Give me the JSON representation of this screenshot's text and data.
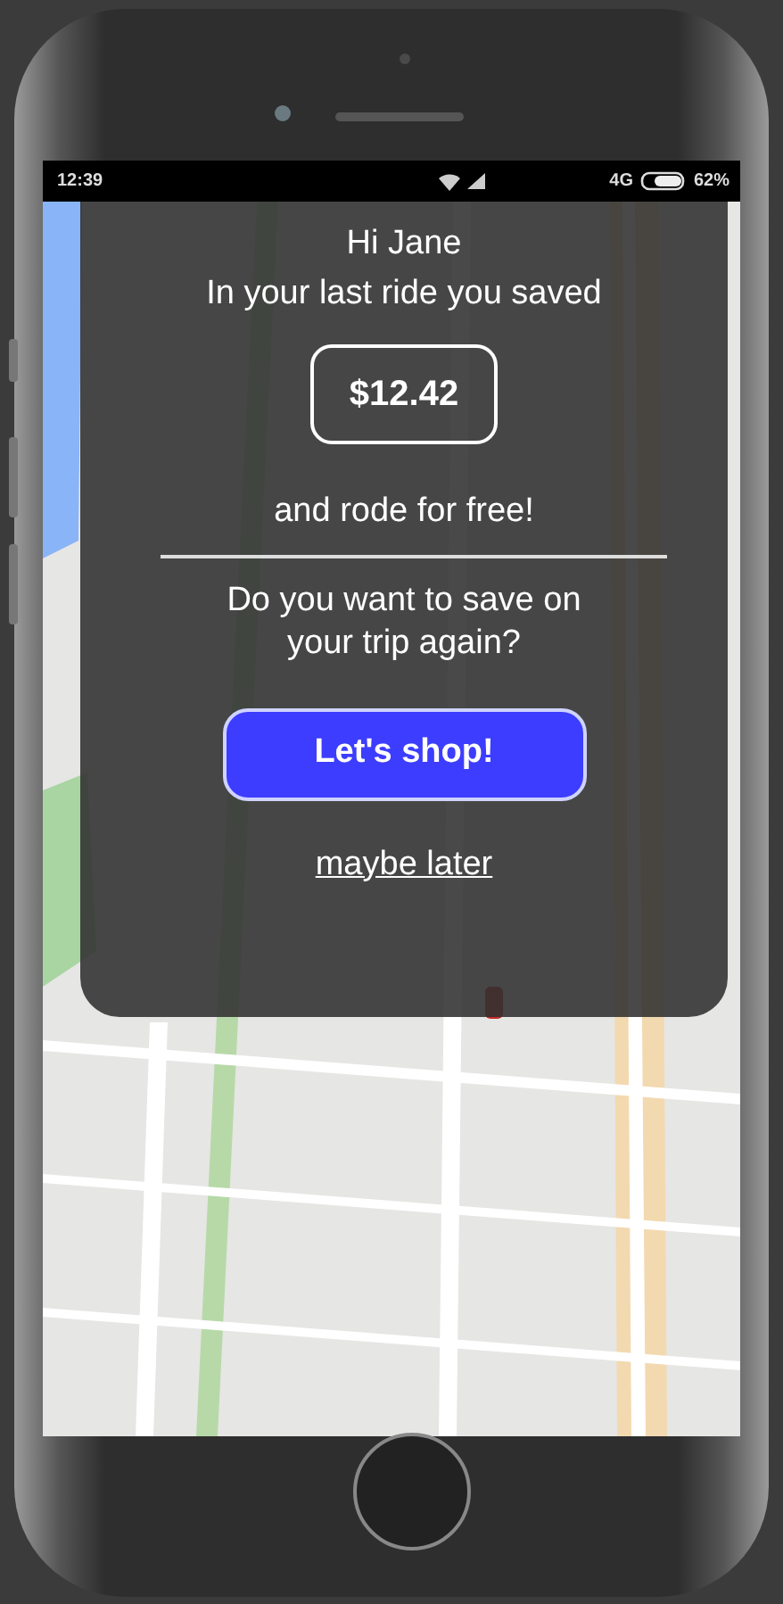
{
  "status_bar": {
    "time": "12:39",
    "network": "4G",
    "battery": "62%"
  },
  "dialog": {
    "greeting": "Hi Jane",
    "message": "In your last ride you saved",
    "amount": "$12.42",
    "note": "and rode for free!",
    "question": "Do you want to save on your trip again?",
    "primary_button": "Let's shop!",
    "secondary_link": "maybe later"
  }
}
